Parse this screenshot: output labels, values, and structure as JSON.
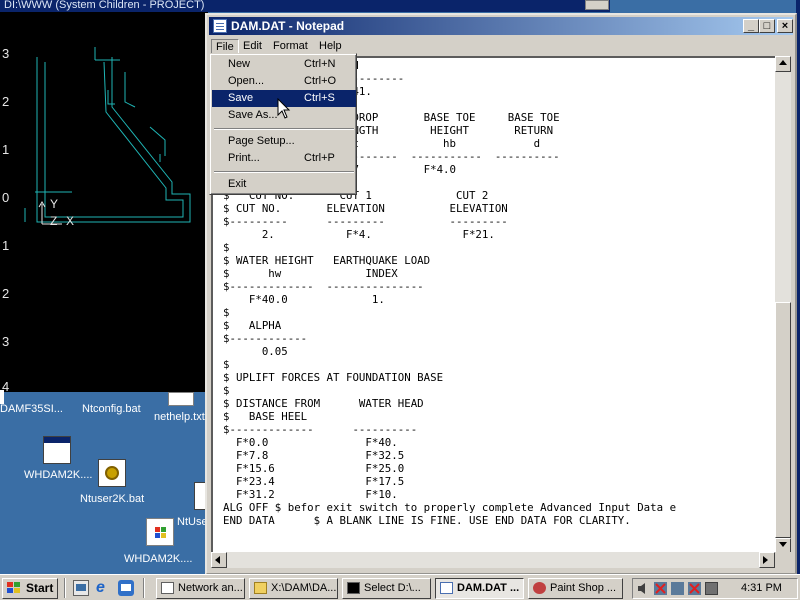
{
  "background_window": {
    "title": "DI:\\WWW (System Children - PROJECT)"
  },
  "cad_view": {
    "axis_ticks": [
      "3",
      "2",
      "1",
      "0",
      "1",
      "2",
      "3",
      "4"
    ],
    "ucs_y": "Y",
    "ucs_z": "Z",
    "ucs_x": "X"
  },
  "desktop_icons": [
    {
      "label": "DAMF35SI...",
      "icon": "file-icon"
    },
    {
      "label": "Ntconfig.bat",
      "icon": "batch-file-icon"
    },
    {
      "label": "nethelp.txt",
      "icon": "text-file-icon"
    },
    {
      "label": "WHDAM2K....",
      "icon": "window-app-icon"
    },
    {
      "label": "Ntuser2K.bat",
      "icon": "batch-file-icon"
    },
    {
      "label": "NtUse",
      "icon": "window-app-icon"
    },
    {
      "label": "WHDAM2K....",
      "icon": "windows-installer-icon"
    }
  ],
  "notepad": {
    "title": "DAM.DAT - Notepad",
    "controls": {
      "minimize": "_",
      "maximize": "□",
      "close": "×"
    },
    "menus": [
      "File",
      "Edit",
      "Format",
      "Help"
    ],
    "text_lines": [
      "$                  hd",
      "$---------------------------",
      "  F*2.7           F*41.",
      "$",
      "$ CUT NO.       TOP DROP       BASE TOE     BASE TOE",
      "$                 LENGTH        HEIGHT       RETURN",
      "$                  ht             hb            d",
      "$-------------  -----------  -----------  ----------",
      "  F*2.7         F*2.7          F*4.0",
      "$",
      "$   CUT NO.       CUT 1             CUT 2",
      "$ CUT NO.       ELEVATION          ELEVATION",
      "$---------      ---------          ---------",
      "      2.           F*4.              F*21.",
      "$",
      "$ WATER HEIGHT   EARTHQUAKE LOAD",
      "$      hw             INDEX",
      "$-------------  ---------------",
      "    F*40.0             1.",
      "$",
      "$   ALPHA",
      "$------------",
      "      0.05",
      "$",
      "$ UPLIFT FORCES AT FOUNDATION BASE",
      "$",
      "$ DISTANCE FROM      WATER HEAD",
      "$   BASE HEEL",
      "$-------------      ----------",
      "  F*0.0               F*40.",
      "  F*7.8               F*32.5",
      "  F*15.6              F*25.0",
      "  F*23.4              F*17.5",
      "  F*31.2              F*10.",
      "ALG OFF $ befor exit switch to properly complete Advanced Input Data e",
      "END DATA      $ A BLANK LINE IS FINE. USE END DATA FOR CLARITY."
    ]
  },
  "file_menu": {
    "items": [
      {
        "label": "New",
        "shortcut": "Ctrl+N"
      },
      {
        "label": "Open...",
        "shortcut": "Ctrl+O"
      },
      {
        "label": "Save",
        "shortcut": "Ctrl+S",
        "selected": true
      },
      {
        "label": "Save As...",
        "shortcut": ""
      },
      {
        "label": "Page Setup...",
        "shortcut": ""
      },
      {
        "label": "Print...",
        "shortcut": "Ctrl+P"
      },
      {
        "label": "Exit",
        "shortcut": ""
      }
    ]
  },
  "taskbar": {
    "start_label": "Start",
    "quick_launch": [
      "show-desktop-icon",
      "internet-explorer-icon",
      "outlook-express-icon"
    ],
    "buttons": [
      {
        "label": "Network an...",
        "icon": "network-icon",
        "active": false
      },
      {
        "label": "X:\\DAM\\DA...",
        "icon": "folder-icon",
        "active": false
      },
      {
        "label": "Select D:\\...",
        "icon": "command-prompt-icon",
        "active": false
      },
      {
        "label": "DAM.DAT ...",
        "icon": "notepad-icon",
        "active": true
      },
      {
        "label": "Paint Shop ...",
        "icon": "paint-shop-icon",
        "active": false
      }
    ],
    "tray_icons": [
      "volume-icon",
      "network-disconnected-icon",
      "network-connection-icon",
      "network-disconnected-icon",
      "printer-icon"
    ],
    "clock": "4:31 PM"
  },
  "colors": {
    "desktop": "#3a6ea5",
    "title_active": "#0a246a",
    "menu_highlight": "#0a246a",
    "cad_lines": "#1fb5b5",
    "cad_background": "#000000"
  }
}
